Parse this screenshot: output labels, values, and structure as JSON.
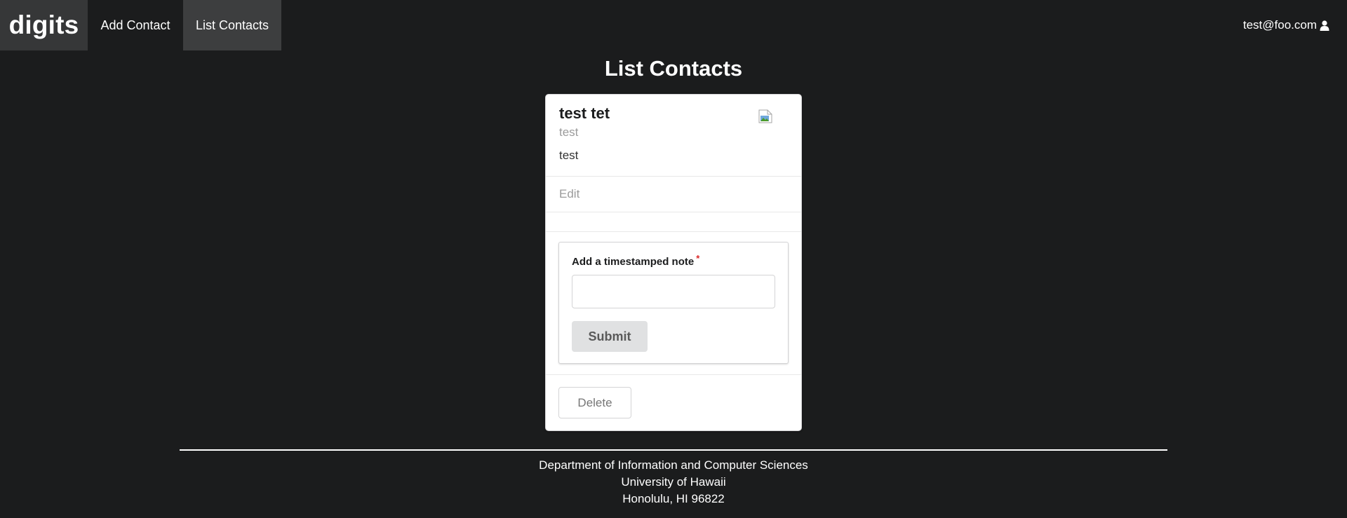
{
  "nav": {
    "brand": "digits",
    "add_contact": "Add Contact",
    "list_contacts": "List Contacts",
    "user_email": "test@foo.com",
    "user_icon": "user-icon"
  },
  "page": {
    "title": "List Contacts"
  },
  "contact": {
    "name": "test tet",
    "meta": "test",
    "description": "test",
    "image_icon": "broken-image-icon",
    "edit_label": "Edit"
  },
  "note_form": {
    "label": "Add a timestamped note",
    "required_marker": "*",
    "value": "",
    "submit_label": "Submit"
  },
  "actions": {
    "delete_label": "Delete"
  },
  "footer": {
    "line1": "Department of Information and Computer Sciences",
    "line2": "University of Hawaii",
    "line3": "Honolulu, HI 96822"
  },
  "colors": {
    "background": "#1b1c1d",
    "active_nav": "#3d3e3f",
    "required": "#db2828"
  }
}
